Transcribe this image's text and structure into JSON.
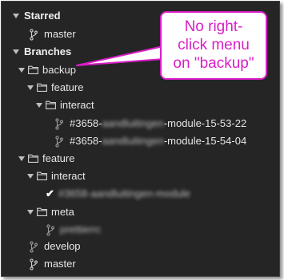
{
  "tree": {
    "starred_header": "Starred",
    "starred_master": "master",
    "branches_header": "Branches",
    "backup": "backup",
    "backup_feature": "feature",
    "backup_feature_interact": "interact",
    "branch_1_prefix": "#3658-",
    "branch_1_blurred": "aandluitingen",
    "branch_1_suffix": "-module-15-53-22",
    "branch_2_prefix": "#3658-",
    "branch_2_blurred": "aandluitingen",
    "branch_2_suffix": "-module-15-54-04",
    "feature": "feature",
    "feature_interact": "interact",
    "current_branch_blurred": "#3658-aandluitingen-module",
    "meta": "meta",
    "meta_item_blurred": "prettierrc",
    "develop": "develop",
    "master": "master"
  },
  "callout": {
    "line1": "No right-",
    "line2": "click menu",
    "line3": "on \"backup\""
  },
  "colors": {
    "panel_background": "#252526",
    "text": "#e6e6e6",
    "annotation": "#d91ec7"
  }
}
